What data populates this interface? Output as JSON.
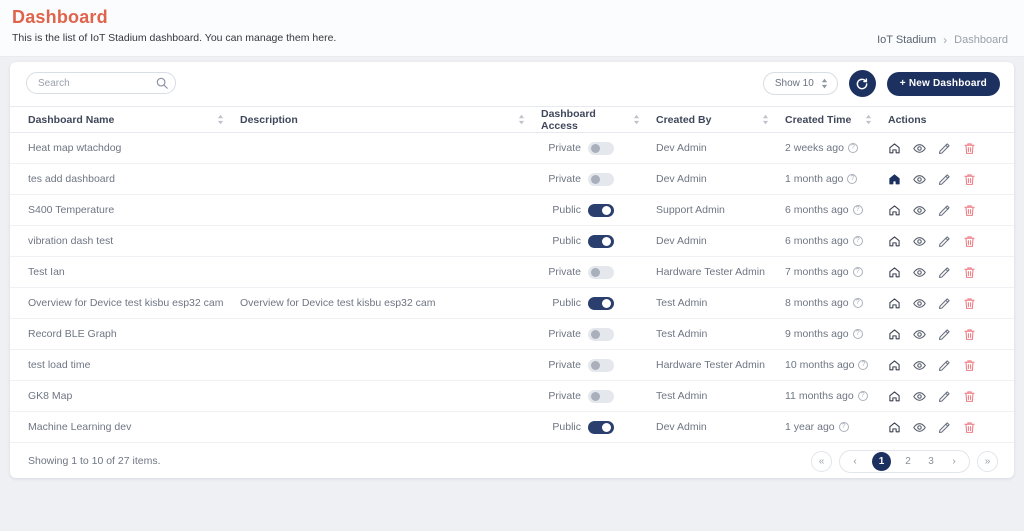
{
  "page": {
    "title": "Dashboard",
    "subtitle": "This is the list of IoT Stadium dashboard. You can manage them here.",
    "breadcrumb": {
      "parent": "IoT Stadium",
      "separator": "›",
      "current": "Dashboard"
    }
  },
  "toolbar": {
    "search_placeholder": "Search",
    "show_label": "Show 10",
    "new_dashboard_label": "+ New Dashboard"
  },
  "table": {
    "columns": [
      "Dashboard Name",
      "Description",
      "Dashboard Access",
      "Created By",
      "Created Time",
      "Actions"
    ],
    "rows": [
      {
        "name": "Heat map wtachdog",
        "description": "",
        "access": "Private",
        "access_on": false,
        "created_by": "Dev Admin",
        "created_time": "2 weeks ago",
        "home_active": false
      },
      {
        "name": "tes add dashboard",
        "description": "",
        "access": "Private",
        "access_on": false,
        "created_by": "Dev Admin",
        "created_time": "1 month ago",
        "home_active": true
      },
      {
        "name": "S400 Temperature",
        "description": "",
        "access": "Public",
        "access_on": true,
        "created_by": "Support Admin",
        "created_time": "6 months ago",
        "home_active": false
      },
      {
        "name": "vibration dash test",
        "description": "",
        "access": "Public",
        "access_on": true,
        "created_by": "Dev Admin",
        "created_time": "6 months ago",
        "home_active": false
      },
      {
        "name": "Test Ian",
        "description": "",
        "access": "Private",
        "access_on": false,
        "created_by": "Hardware Tester Admin",
        "created_time": "7 months ago",
        "home_active": false
      },
      {
        "name": "Overview for Device test kisbu esp32 cam",
        "description": "Overview for Device test kisbu esp32 cam",
        "access": "Public",
        "access_on": true,
        "created_by": "Test Admin",
        "created_time": "8 months ago",
        "home_active": false
      },
      {
        "name": "Record BLE Graph",
        "description": "",
        "access": "Private",
        "access_on": false,
        "created_by": "Test Admin",
        "created_time": "9 months ago",
        "home_active": false
      },
      {
        "name": "test load time",
        "description": "",
        "access": "Private",
        "access_on": false,
        "created_by": "Hardware Tester Admin",
        "created_time": "10 months ago",
        "home_active": false
      },
      {
        "name": "GK8 Map",
        "description": "",
        "access": "Private",
        "access_on": false,
        "created_by": "Test Admin",
        "created_time": "11 months ago",
        "home_active": false
      },
      {
        "name": "Machine Learning dev",
        "description": "",
        "access": "Public",
        "access_on": true,
        "created_by": "Dev Admin",
        "created_time": "1 year ago",
        "home_active": false
      }
    ]
  },
  "footer": {
    "showing_text": "Showing 1 to 10 of 27 items.",
    "pagination": {
      "first": "«",
      "prev": "‹",
      "pages": [
        "1",
        "2",
        "3"
      ],
      "active_page": "1",
      "next": "›",
      "last": "»"
    }
  },
  "colors": {
    "accent_navy": "#1d3160",
    "title_orange": "#e0634c",
    "danger_red": "#ee7e86",
    "toggle_off_track": "#e4e7ec"
  }
}
